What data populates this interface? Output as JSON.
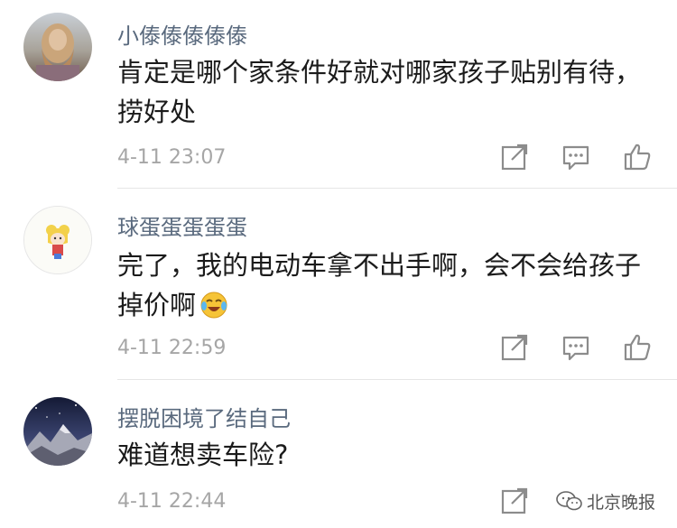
{
  "comments": [
    {
      "username": "小傣傣傣傣傣",
      "text": "肯定是哪个家条件好就对哪家孩子贴别有待，捞好处",
      "time": "4-11 23:07",
      "avatar": "woman-photo-avatar"
    },
    {
      "username": "球蛋蛋蛋蛋蛋",
      "text": "完了，我的电动车拿不出手啊，会不会给孩子掉价啊",
      "emoji": "crying-laughing-emoji",
      "time": "4-11 22:59",
      "avatar": "cartoon-girl-avatar"
    },
    {
      "username": "摆脱困境了结自己",
      "text": "难道想卖车险?",
      "time": "4-11 22:44",
      "avatar": "mountain-night-avatar"
    }
  ],
  "actions": [
    "share-icon",
    "reply-icon",
    "like-icon"
  ],
  "watermark": {
    "text": "北京晚报"
  },
  "colors": {
    "username": "#5a6a7e",
    "text": "#1b1b1b",
    "time": "#a6a6a6",
    "icon": "#8c8c8c",
    "divider": "#e6e6e6"
  }
}
